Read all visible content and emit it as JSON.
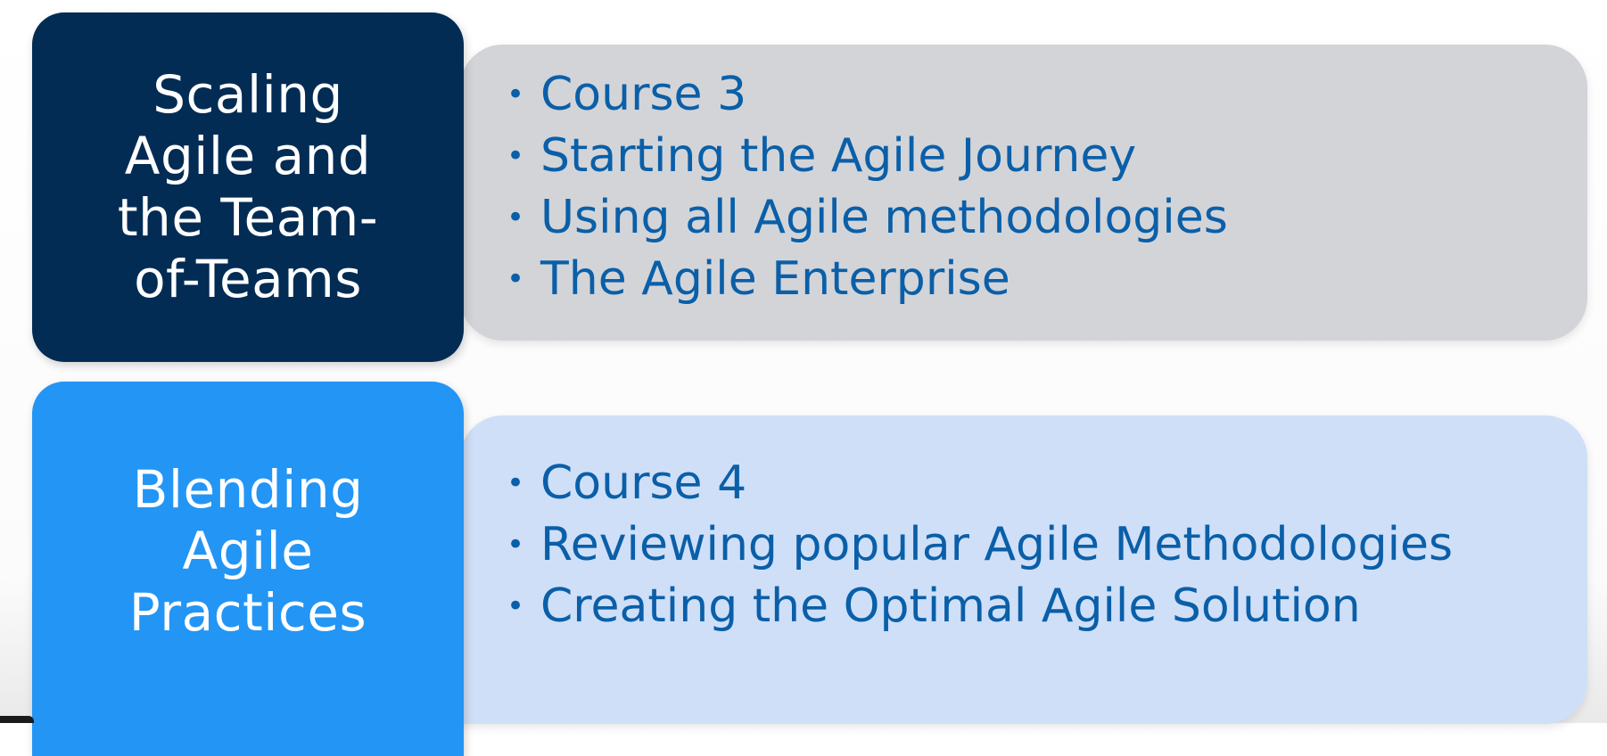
{
  "rows": [
    {
      "title": "Scaling\nAgile and\nthe Team-\nof-Teams",
      "bullets": [
        "Course 3",
        "Starting the Agile Journey",
        "Using all Agile methodologies",
        "The Agile Enterprise"
      ]
    },
    {
      "title": "Blending\nAgile\nPractices",
      "bullets": [
        "Course 4",
        "Reviewing popular Agile Methodologies",
        "Creating the Optimal Agile Solution"
      ]
    }
  ],
  "colors": {
    "dark_navy": "#032c55",
    "bright_blue": "#2395f5",
    "grey_panel": "#d3d4d8",
    "light_blue_panel": "#cfdff8",
    "bullet_text": "#0a5fa8"
  },
  "bullet_glyph": "•"
}
